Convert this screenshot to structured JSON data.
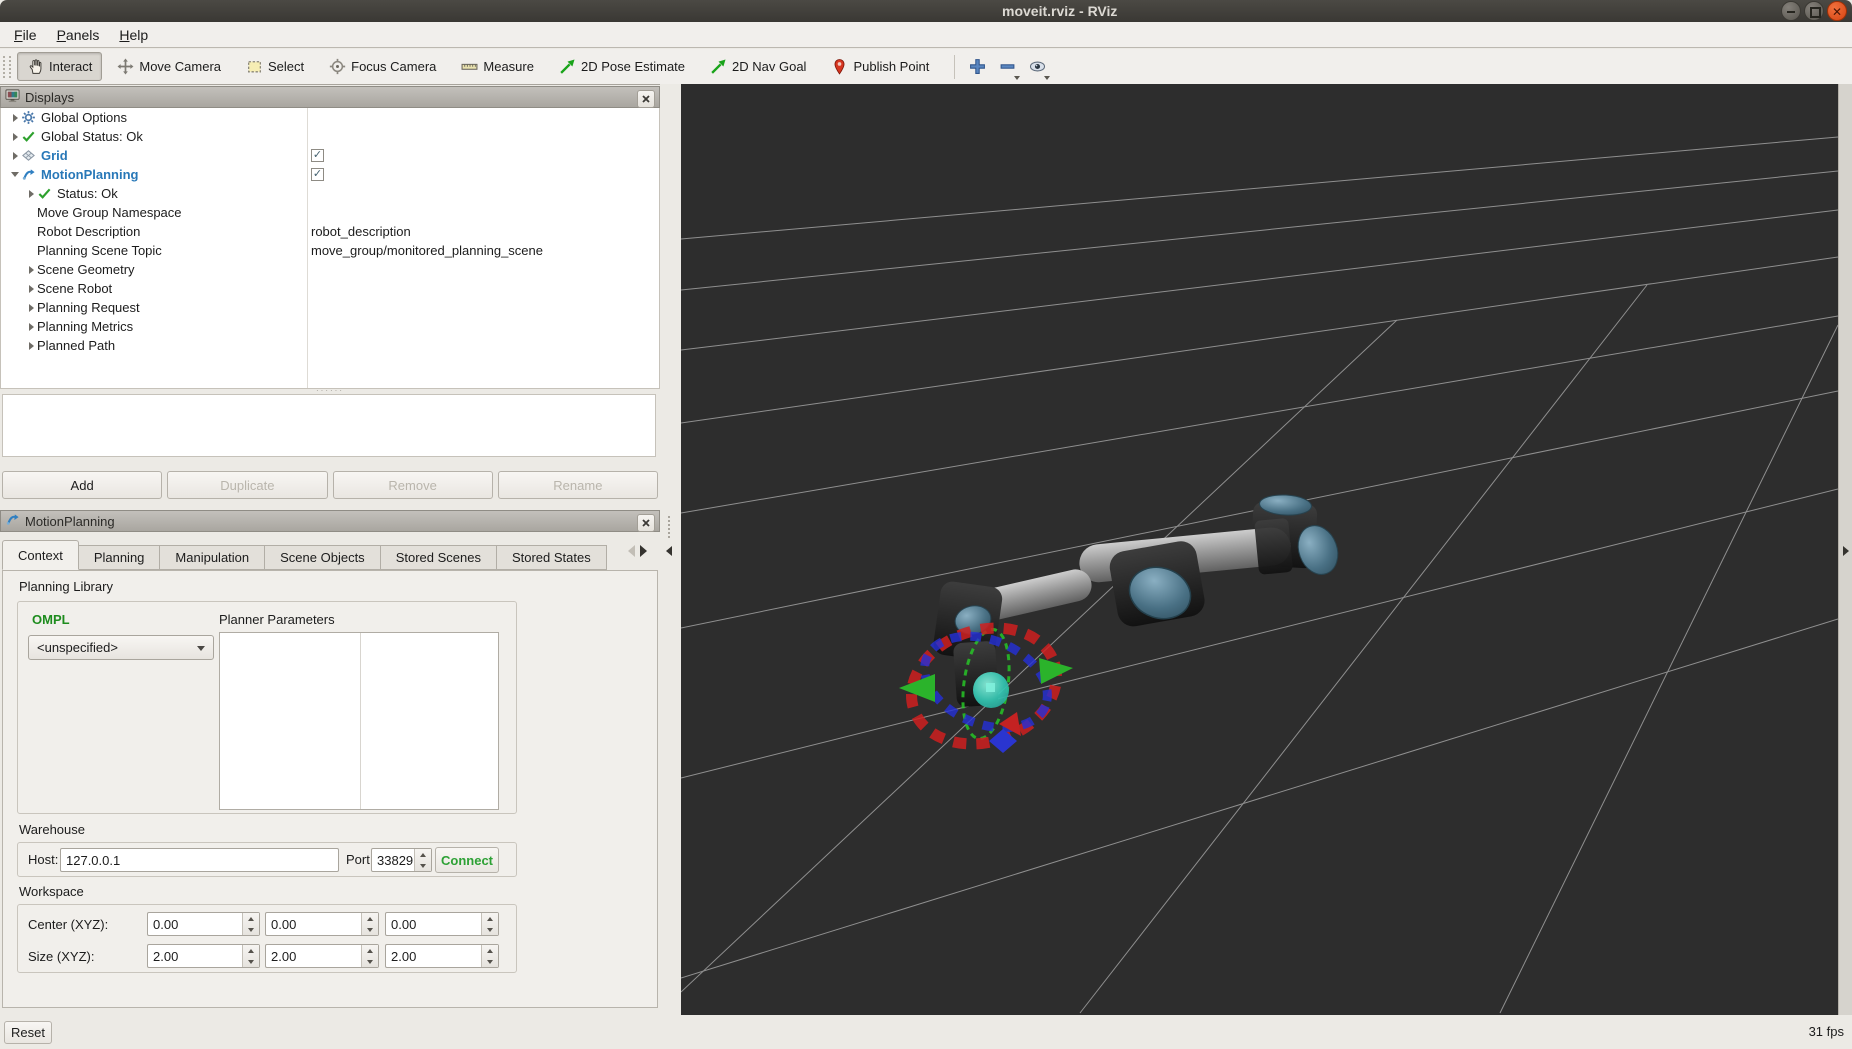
{
  "window": {
    "title": "moveit.rviz - RViz"
  },
  "menu": {
    "items": [
      {
        "label": "File"
      },
      {
        "label": "Panels"
      },
      {
        "label": "Help"
      }
    ]
  },
  "toolbar": {
    "tools": [
      {
        "label": "Interact",
        "icon": "hand-icon",
        "active": true
      },
      {
        "label": "Move Camera",
        "icon": "move-camera-icon",
        "active": false
      },
      {
        "label": "Select",
        "icon": "select-box-icon",
        "active": false
      },
      {
        "label": "Focus Camera",
        "icon": "focus-target-icon",
        "active": false
      },
      {
        "label": "Measure",
        "icon": "ruler-icon",
        "active": false
      },
      {
        "label": "2D Pose Estimate",
        "icon": "pose-arrow-icon",
        "active": false
      },
      {
        "label": "2D Nav Goal",
        "icon": "nav-goal-arrow-icon",
        "active": false
      },
      {
        "label": "Publish Point",
        "icon": "map-pin-icon",
        "active": false
      }
    ],
    "extras": [
      {
        "icon": "plus-icon",
        "dropdown": false
      },
      {
        "icon": "minus-icon",
        "dropdown": true
      },
      {
        "icon": "eye-icon",
        "dropdown": true
      }
    ]
  },
  "displays_panel": {
    "title": "Displays",
    "tree": [
      {
        "expander": "collapsed",
        "icon": "gear-icon",
        "label": "Global Options",
        "indent": 0
      },
      {
        "expander": "collapsed",
        "icon": "check-icon",
        "label": "Global Status: Ok",
        "indent": 0
      },
      {
        "expander": "collapsed",
        "icon": "grid-icon",
        "label": "Grid",
        "indent": 0,
        "blue": true,
        "checkbox": true
      },
      {
        "expander": "expanded",
        "icon": "motionplanning-icon",
        "label": "MotionPlanning",
        "indent": 0,
        "blue": true,
        "checkbox": true
      },
      {
        "expander": "collapsed",
        "icon": "check-icon",
        "label": "Status: Ok",
        "indent": 1
      },
      {
        "label": "Move Group Namespace",
        "indent": 1
      },
      {
        "label": "Robot Description",
        "indent": 1,
        "value": "robot_description"
      },
      {
        "label": "Planning Scene Topic",
        "indent": 1,
        "value": "move_group/monitored_planning_scene"
      },
      {
        "expander": "collapsed",
        "label": "Scene Geometry",
        "indent": 1
      },
      {
        "expander": "collapsed",
        "label": "Scene Robot",
        "indent": 1
      },
      {
        "expander": "collapsed",
        "label": "Planning Request",
        "indent": 1
      },
      {
        "expander": "collapsed",
        "label": "Planning Metrics",
        "indent": 1
      },
      {
        "expander": "collapsed",
        "label": "Planned Path",
        "indent": 1
      }
    ],
    "buttons": [
      {
        "label": "Add",
        "enabled": true
      },
      {
        "label": "Duplicate",
        "enabled": false
      },
      {
        "label": "Remove",
        "enabled": false
      },
      {
        "label": "Rename",
        "enabled": false
      }
    ]
  },
  "motion_panel": {
    "title": "MotionPlanning",
    "tabs": [
      "Context",
      "Planning",
      "Manipulation",
      "Scene Objects",
      "Stored Scenes",
      "Stored States"
    ],
    "active_tab": "Context",
    "context": {
      "section_planning_library": "Planning Library",
      "library_name": "OMPL",
      "planner_select": "<unspecified>",
      "planner_params_label": "Planner Parameters",
      "section_warehouse": "Warehouse",
      "host_label": "Host:",
      "host_value": "127.0.0.1",
      "port_label": "Port:",
      "port_value": "33829",
      "connect_label": "Connect",
      "section_workspace": "Workspace",
      "center_label": "Center (XYZ):",
      "size_label": "Size (XYZ):",
      "center_values": [
        "0.00",
        "0.00",
        "0.00"
      ],
      "size_values": [
        "2.00",
        "2.00",
        "2.00"
      ]
    }
  },
  "statusbar": {
    "reset_label": "Reset",
    "fps": "31 fps"
  },
  "colors": {
    "viewport_background": "#2d2d2d",
    "grid_line": "#8f8f8f",
    "display_name_blue": "#2878b8",
    "library_green": "#1e8c1e",
    "connect_green": "#2da135",
    "close_button_orange": "#e25420",
    "marker_red": "#cf2020",
    "marker_blue": "#2430d8",
    "marker_green": "#2bb32b",
    "marker_teal": "#35c8b4"
  }
}
